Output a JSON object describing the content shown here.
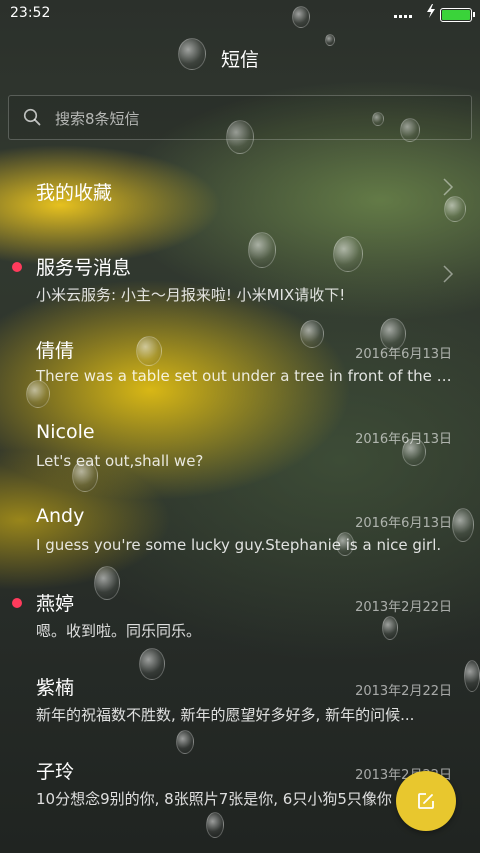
{
  "status_bar": {
    "time": "23:52",
    "battery_color": "#3ad33a"
  },
  "header": {
    "title": "短信"
  },
  "search": {
    "placeholder": "搜索8条短信"
  },
  "threads": [
    {
      "name": "我的收藏",
      "preview": "",
      "date": "",
      "unread": false,
      "chevron": true
    },
    {
      "name": "服务号消息",
      "preview": "小米云服务: 小主～月报来啦! 小米MIX请收下!",
      "date": "",
      "unread": true,
      "chevron": true
    },
    {
      "name": "倩倩",
      "preview": "There was a table set out under a tree in front of the ho...",
      "date": "2016年6月13日",
      "unread": false
    },
    {
      "name": "Nicole",
      "preview": "Let's eat out,shall we?",
      "date": "2016年6月13日",
      "unread": false
    },
    {
      "name": "Andy",
      "preview": "I guess you're some lucky guy.Stephanie is a nice girl.",
      "date": "2016年6月13日",
      "unread": false
    },
    {
      "name": "燕婷",
      "preview": "嗯。收到啦。同乐同乐。",
      "date": "2013年2月22日",
      "unread": true
    },
    {
      "name": "紫楠",
      "preview": "新年的祝福数不胜数, 新年的愿望好多好多, 新年的问候...",
      "date": "2013年2月22日",
      "unread": false
    },
    {
      "name": "子玲",
      "preview": "10分想念9别的你, 8张照片7张是你, 6只小狗5只像你",
      "date": "2013年2月22日",
      "unread": false
    }
  ],
  "colors": {
    "unread_dot": "#ff3b5c",
    "fab": "#e8c72e"
  },
  "icons": {
    "search": "search-icon",
    "compose": "compose-icon",
    "chevron": "chevron-right-icon"
  }
}
